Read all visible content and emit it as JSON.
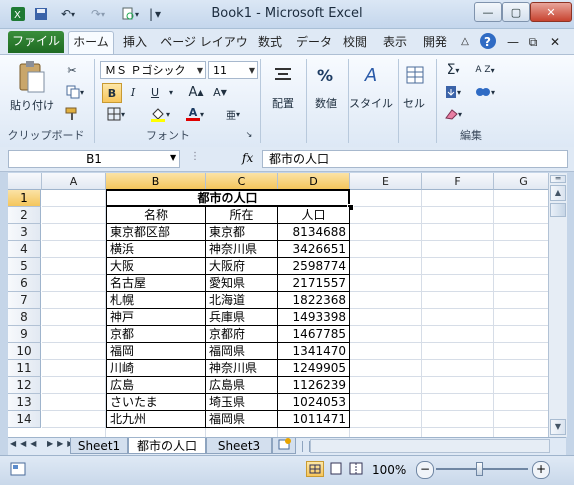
{
  "window": {
    "title": "Book1  -  Microsoft Excel"
  },
  "qat": {
    "separator": "|",
    "more": "▾"
  },
  "ribbon_tabs": [
    "ファイル",
    "ホーム",
    "挿入",
    "ページ レイアウト",
    "数式",
    "データ",
    "校閲",
    "表示",
    "開発"
  ],
  "ribbon": {
    "clipboard": {
      "label": "クリップボード",
      "paste": "貼り付け"
    },
    "font": {
      "label": "フォント",
      "name": "ＭＳ Ｐゴシック",
      "size": "11",
      "bold": "B",
      "italic": "I",
      "underline": "U",
      "grow": "A",
      "shrink": "A",
      "color_letter": "A",
      "font_color": "#e00000",
      "phonetic": "亜"
    },
    "alignment": {
      "label": "配置"
    },
    "number": {
      "label": "数値",
      "glyph": "%"
    },
    "styles": {
      "label": "スタイル",
      "glyph": "A"
    },
    "cells": {
      "label": "セル"
    },
    "editing": {
      "label": "編集",
      "sum": "Σ",
      "sort": "A Z"
    }
  },
  "formula_bar": {
    "name_box": "B1",
    "fx": "fx",
    "formula": "都市の人口"
  },
  "columns": [
    "A",
    "B",
    "C",
    "D",
    "E",
    "F",
    "G"
  ],
  "rows": [
    "1",
    "2",
    "3",
    "4",
    "5",
    "6",
    "7",
    "8",
    "9",
    "10",
    "11",
    "12",
    "13",
    "14"
  ],
  "table": {
    "title": "都市の人口",
    "headers": [
      "名称",
      "所在",
      "人口"
    ],
    "data": [
      [
        "東京都区部",
        "東京都",
        "8134688"
      ],
      [
        "横浜",
        "神奈川県",
        "3426651"
      ],
      [
        "大阪",
        "大阪府",
        "2598774"
      ],
      [
        "名古屋",
        "愛知県",
        "2171557"
      ],
      [
        "札幌",
        "北海道",
        "1822368"
      ],
      [
        "神戸",
        "兵庫県",
        "1493398"
      ],
      [
        "京都",
        "京都府",
        "1467785"
      ],
      [
        "福岡",
        "福岡県",
        "1341470"
      ],
      [
        "川崎",
        "神奈川県",
        "1249905"
      ],
      [
        "広島",
        "広島県",
        "1126239"
      ],
      [
        "さいたま",
        "埼玉県",
        "1024053"
      ],
      [
        "北九州",
        "福岡県",
        "1011471"
      ]
    ]
  },
  "sheets": [
    "Sheet1",
    "都市の人口",
    "Sheet3"
  ],
  "status": {
    "zoom": "100%"
  },
  "colors": {
    "accent_green": "#1e6a22",
    "selection": "#f4c55c"
  }
}
